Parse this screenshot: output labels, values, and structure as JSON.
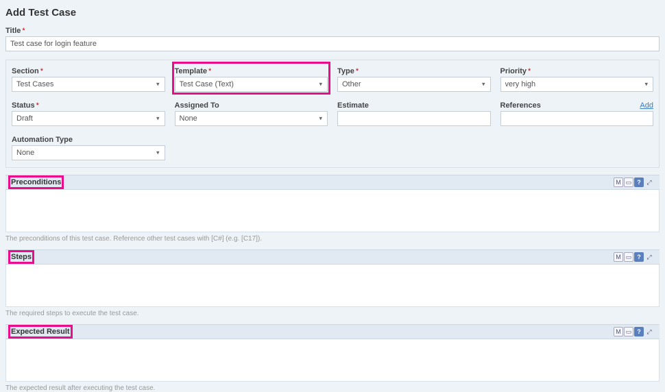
{
  "pageTitle": "Add Test Case",
  "title": {
    "label": "Title",
    "value": "Test case for login feature"
  },
  "fields": {
    "section": {
      "label": "Section",
      "value": "Test Cases",
      "required": true
    },
    "template": {
      "label": "Template",
      "value": "Test Case (Text)",
      "required": true
    },
    "type": {
      "label": "Type",
      "value": "Other",
      "required": true
    },
    "priority": {
      "label": "Priority",
      "value": "very high",
      "required": true
    },
    "status": {
      "label": "Status",
      "value": "Draft",
      "required": true
    },
    "assignedTo": {
      "label": "Assigned To",
      "value": "None",
      "required": false
    },
    "estimate": {
      "label": "Estimate",
      "value": "",
      "required": false
    },
    "references": {
      "label": "References",
      "value": "",
      "required": false,
      "addLabel": "Add"
    },
    "automationType": {
      "label": "Automation Type",
      "value": "None",
      "required": false
    }
  },
  "sections": {
    "preconditions": {
      "title": "Preconditions",
      "hint": "The preconditions of this test case. Reference other test cases with [C#] (e.g. [C17])."
    },
    "steps": {
      "title": "Steps",
      "hint": "The required steps to execute the test case."
    },
    "expected": {
      "title": "Expected Result",
      "hint": "The expected result after executing the test case."
    }
  },
  "reqMark": "*",
  "iconLabels": {
    "markdown": "M",
    "image": "▭",
    "help": "?",
    "expand": "⤢"
  }
}
